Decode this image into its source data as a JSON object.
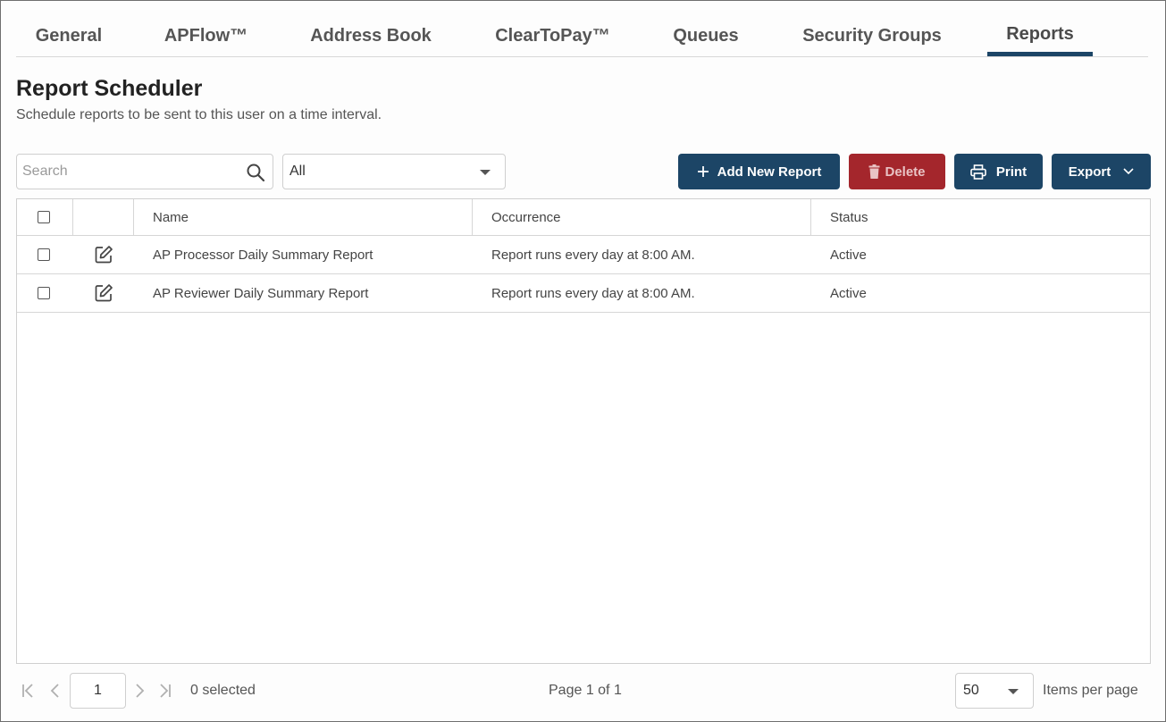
{
  "tabs": [
    {
      "label": "General"
    },
    {
      "label": "APFlow™"
    },
    {
      "label": "Address Book"
    },
    {
      "label": "ClearToPay™"
    },
    {
      "label": "Queues"
    },
    {
      "label": "Security Groups"
    },
    {
      "label": "Reports",
      "active": true
    }
  ],
  "page": {
    "title": "Report Scheduler",
    "subtitle": "Schedule reports to be sent to this user on a time interval."
  },
  "search": {
    "placeholder": "Search",
    "value": ""
  },
  "filter": {
    "selected": "All"
  },
  "toolbar": {
    "add_label": "Add New Report",
    "delete_label": "Delete",
    "print_label": "Print",
    "export_label": "Export"
  },
  "table": {
    "columns": [
      "Name",
      "Occurrence",
      "Status"
    ],
    "rows": [
      {
        "name": "AP Processor Daily Summary Report",
        "occurrence": "Report runs every day at 8:00 AM.",
        "status": "Active"
      },
      {
        "name": "AP Reviewer Daily Summary Report",
        "occurrence": "Report runs every day at 8:00 AM.",
        "status": "Active"
      }
    ]
  },
  "pager": {
    "current_page": "1",
    "selected_text": "0 selected",
    "page_text": "Page 1 of 1",
    "page_size": "50",
    "items_per_page_label": "Items per page"
  },
  "colors": {
    "primary": "#1c4566",
    "danger": "#a4262c"
  },
  "icons": {
    "search": "search-icon",
    "add": "plus-icon",
    "delete": "trash-icon",
    "print": "printer-icon",
    "export": "chevron-down-icon",
    "edit": "edit-icon"
  }
}
